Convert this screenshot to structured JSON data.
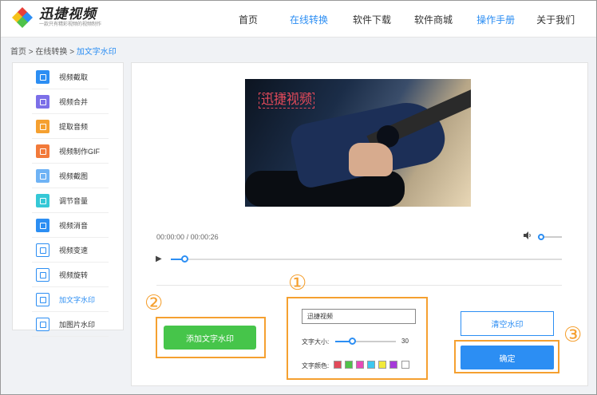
{
  "brand": {
    "name": "迅捷视频",
    "tagline": "一款只有精彩视频的视频制作"
  },
  "nav": [
    {
      "label": "首页",
      "active": false
    },
    {
      "label": "在线转换",
      "active": true
    },
    {
      "label": "软件下载",
      "active": false
    },
    {
      "label": "软件商城",
      "active": false
    },
    {
      "label": "操作手册",
      "active": true
    },
    {
      "label": "关于我们",
      "active": false
    }
  ],
  "breadcrumb": {
    "home": "首页",
    "sep": ">",
    "section": "在线转换",
    "current": "加文字水印"
  },
  "sidebar": [
    {
      "label": "视频截取",
      "icon": "crop-icon",
      "color": "#2c8ef3"
    },
    {
      "label": "视频合并",
      "icon": "merge-icon",
      "color": "#7c6fe8"
    },
    {
      "label": "提取音频",
      "icon": "headphones-icon",
      "color": "#f5a030"
    },
    {
      "label": "视频制作GIF",
      "icon": "gif-icon",
      "color": "#f27a3a"
    },
    {
      "label": "视频截图",
      "icon": "scissors-icon",
      "color": "#6fb3f5"
    },
    {
      "label": "调节音量",
      "icon": "volume-icon",
      "color": "#35c8d6"
    },
    {
      "label": "视频消音",
      "icon": "mute-icon",
      "color": "#2c8ef3"
    },
    {
      "label": "视频变速",
      "icon": "speed-icon",
      "color": "#2c8ef3"
    },
    {
      "label": "视频旋转",
      "icon": "rotate-icon",
      "color": "#35b8f0"
    },
    {
      "label": "加文字水印",
      "icon": "text-icon",
      "color": "#2c8ef3",
      "active": true
    },
    {
      "label": "加图片水印",
      "icon": "image-icon",
      "color": "#2c8ef3"
    }
  ],
  "video": {
    "watermark": "迅捷视频"
  },
  "player": {
    "current": "00:00:00",
    "sep": "/",
    "duration": "00:00:26",
    "progress": 0.03,
    "volume": 0.15
  },
  "controls": {
    "text_value": "迅捷视频",
    "size_label": "文字大小:",
    "size_value": "30",
    "size_fraction": 0.25,
    "color_label": "文字颜色:",
    "colors": [
      "#e24a5a",
      "#4fc24a",
      "#e84ab8",
      "#3ec8f0",
      "#f2ea3a",
      "#a63ad9",
      "#ffffff"
    ],
    "add_button": "添加文字水印",
    "clear_button": "清空水印",
    "ok_button": "确定"
  },
  "markers": [
    "①",
    "②",
    "③"
  ]
}
